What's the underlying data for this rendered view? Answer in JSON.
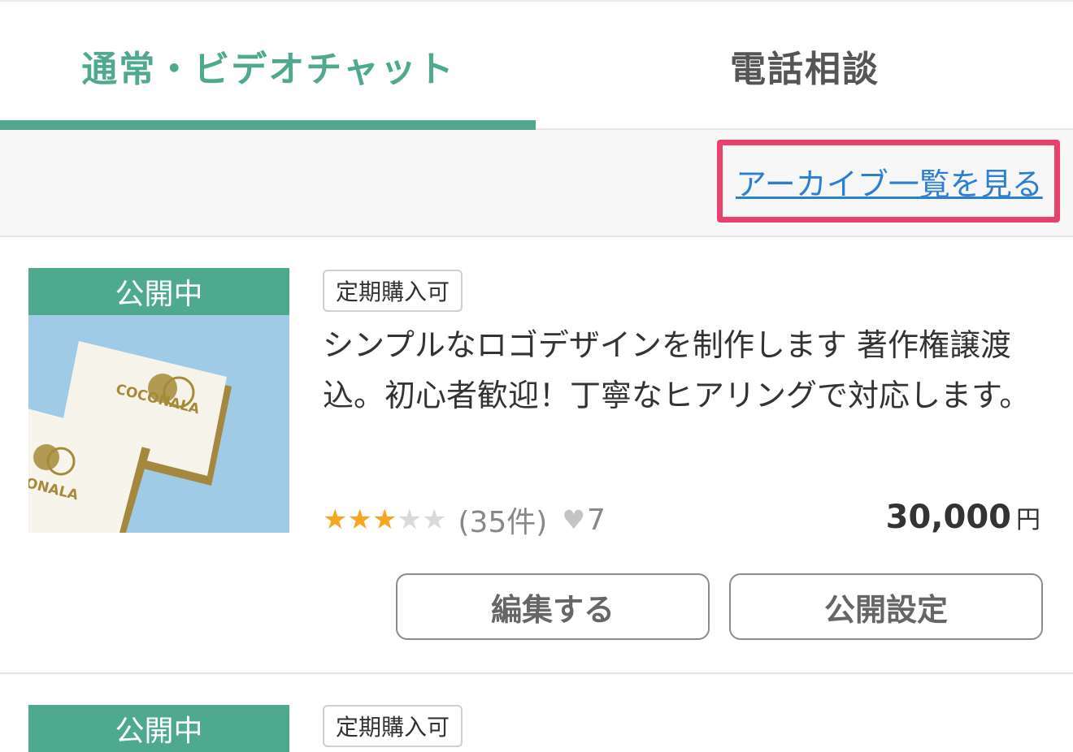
{
  "tabs": [
    {
      "label": "通常・ビデオチャット",
      "active": true
    },
    {
      "label": "電話相談",
      "active": false
    }
  ],
  "archive_link": "アーカイブ一覧を見る",
  "colors": {
    "accent": "#4fa98f",
    "highlight": "#e8416e",
    "link": "#2d7fd3",
    "star": "#f5a623"
  },
  "items": [
    {
      "status": "公開中",
      "tag": "定期購入可",
      "title": "シンプルなロゴデザインを制作します 著作権譲渡込。初心者歓迎！丁寧なヒアリングで対応します。",
      "rating": 3,
      "rating_max": 5,
      "review_count": "(35件)",
      "heart_icon": "heart-icon",
      "likes": "7",
      "price": "30,000",
      "price_unit": "円",
      "edit_label": "編集する",
      "public_label": "公開設定",
      "thumbnail_text": [
        "COCONALA",
        "ONALA"
      ]
    },
    {
      "status": "公開中",
      "tag": "定期購入可"
    }
  ]
}
